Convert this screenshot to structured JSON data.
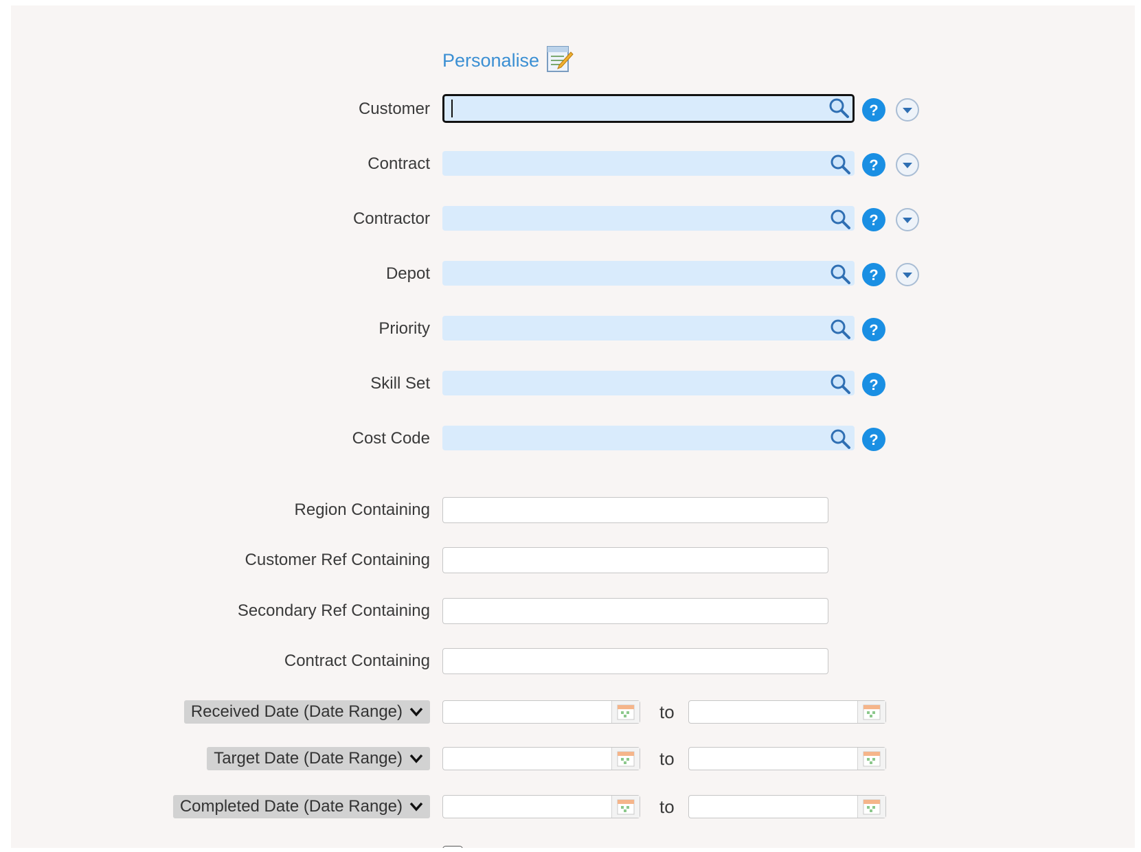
{
  "header": {
    "personalise_label": "Personalise",
    "personalise_icon": "edit-form-icon"
  },
  "lookup_fields": [
    {
      "label": "Customer",
      "value": "",
      "has_dropdown": true,
      "focused": true
    },
    {
      "label": "Contract",
      "value": "",
      "has_dropdown": true
    },
    {
      "label": "Contractor",
      "value": "",
      "has_dropdown": true
    },
    {
      "label": "Depot",
      "value": "",
      "has_dropdown": true
    },
    {
      "label": "Priority",
      "value": "",
      "has_dropdown": false
    },
    {
      "label": "Skill Set",
      "value": "",
      "has_dropdown": false
    },
    {
      "label": "Cost Code",
      "value": "",
      "has_dropdown": false
    }
  ],
  "text_fields": [
    {
      "label": "Region Containing",
      "value": ""
    },
    {
      "label": "Customer Ref Containing",
      "value": ""
    },
    {
      "label": "Secondary Ref Containing",
      "value": ""
    },
    {
      "label": "Contract Containing",
      "value": ""
    }
  ],
  "date_ranges": [
    {
      "selector": "Received Date (Date Range)",
      "separator": "to",
      "from": "",
      "to": ""
    },
    {
      "selector": "Target Date (Date Range)",
      "separator": "to",
      "from": "",
      "to": ""
    },
    {
      "selector": "Completed Date (Date Range)",
      "separator": "to",
      "from": "",
      "to": ""
    }
  ],
  "colors": {
    "lookup_background": "#d9ebfc",
    "help_icon": "#1a8fe3",
    "link": "#3b8fd3",
    "panel_background": "#f8f5f4"
  }
}
